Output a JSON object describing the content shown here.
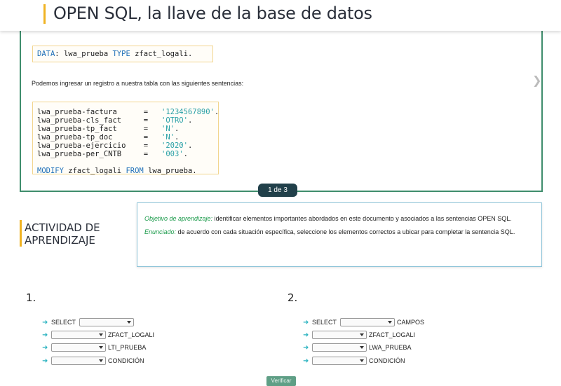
{
  "header": {
    "title": "OPEN SQL, la llave de la base de datos"
  },
  "slide": {
    "code1": {
      "kw1": "DATA",
      "rest1": ": lwa_prueba ",
      "kw2": "TYPE",
      "rest2": " zfact_logali."
    },
    "paragraph": "Podemos ingresar un registro a nuestra tabla con las siguientes sentencias:",
    "assignments": [
      {
        "field": "lwa_prueba-factura      ",
        "value": "'1234567890'"
      },
      {
        "field": "lwa_prueba-cls_fact     ",
        "value": "'OTRO'"
      },
      {
        "field": "lwa_prueba-tp_fact      ",
        "value": "'N'"
      },
      {
        "field": "lwa_prueba-tp_doc       ",
        "value": "'N'"
      },
      {
        "field": "lwa_prueba-ejercicio    ",
        "value": "'2020'"
      },
      {
        "field": "lwa_prueba-per_CNTB     ",
        "value": "'003'"
      }
    ],
    "modify": {
      "kw1": "MODIFY",
      "mid": " zfact_logali ",
      "kw2": "FROM",
      "end": " lwa_prueba."
    },
    "pager": "1 de 3"
  },
  "activity": {
    "title": "ACTIVIDAD DE APRENDIZAJE",
    "objective_label": "Objetivo de aprendizaje:",
    "objective_text": " identificar elementos importantes abordados en este documento y asociados a las sentencias OPEN SQL.",
    "statement_label": "Enunciado:",
    "statement_text": " de acuerdo con cada situación específica, seleccione los elementos correctos a ubicar para completar la sentencia SQL."
  },
  "exercise1": {
    "number": "1.",
    "select_label": "SELECT",
    "table": "ZFACT_LOGALI",
    "into": "LTI_PRUEBA",
    "cond": "CONDICIÓN"
  },
  "exercise2": {
    "number": "2.",
    "select_label": "SELECT",
    "after_select": "CAMPOS",
    "table": "ZFACT_LOGALI",
    "into": "LWA_PRUEBA",
    "cond": "CONDICIÓN"
  },
  "verify_label": "Verificar"
}
